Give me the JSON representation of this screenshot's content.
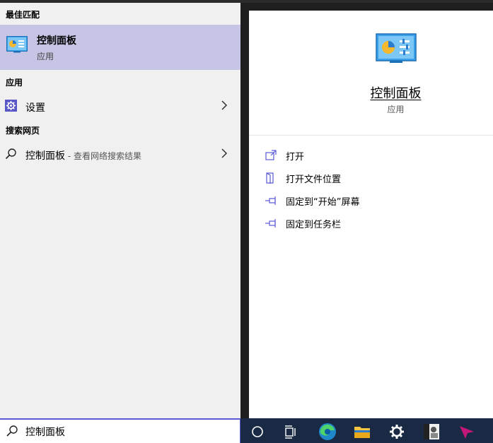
{
  "sections": {
    "best_match": "最佳匹配",
    "apps": "应用",
    "web": "搜索网页"
  },
  "best_match": {
    "title": "控制面板",
    "subtitle": "应用",
    "icon": "control-panel-icon"
  },
  "apps": [
    {
      "label": "设置",
      "icon": "gear-icon"
    }
  ],
  "web": [
    {
      "label": "控制面板",
      "hint": " - 查看网络搜索结果",
      "icon": "search-icon"
    }
  ],
  "detail": {
    "title": "控制面板",
    "subtitle": "应用",
    "actions": [
      {
        "label": "打开",
        "icon": "open-icon"
      },
      {
        "label": "打开文件位置",
        "icon": "file-location-icon"
      },
      {
        "label": "固定到“开始”屏幕",
        "icon": "pin-icon"
      },
      {
        "label": "固定到任务栏",
        "icon": "pin-icon"
      }
    ]
  },
  "search": {
    "value": "控制面板"
  },
  "taskbar": {
    "items": [
      "cortana-icon",
      "task-view-icon",
      "edge-icon",
      "file-explorer-icon",
      "settings-icon",
      "photo-app-icon",
      "pointer-app-icon"
    ]
  },
  "colors": {
    "selection": "#c7c5e6",
    "accent": "#5b5bd6",
    "taskbar": "#1a2a44"
  }
}
